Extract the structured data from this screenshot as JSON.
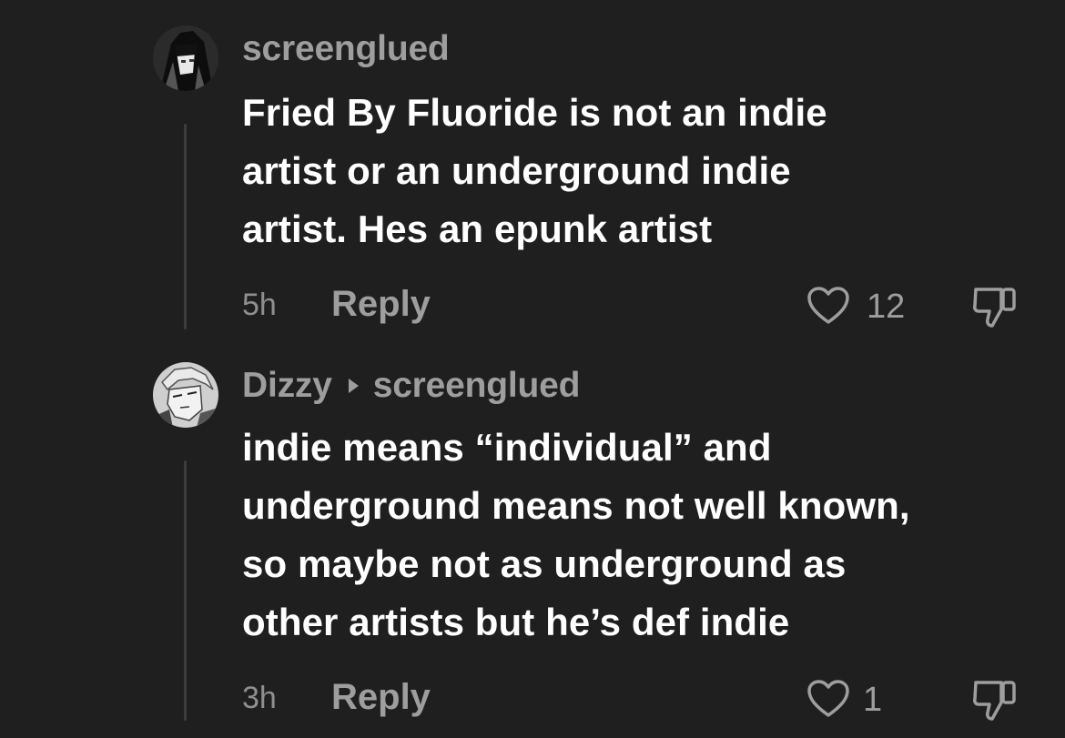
{
  "comments": [
    {
      "username": "screenglued",
      "reply_to": "",
      "text": "Fried By Fluoride is not an indie artist or an underground indie artist. Hes an epunk artist",
      "lines": [
        "Fried By Fluoride is not an indie",
        "artist or an underground indie",
        "artist. Hes an epunk artist"
      ],
      "time": "5h",
      "reply_label": "Reply",
      "likes": "12"
    },
    {
      "username": "Dizzy",
      "reply_to": "screenglued",
      "text": "indie means “individual” and underground means not well known, so maybe not as underground as other artists but he’s def indie",
      "lines": [
        "indie means “individual” and",
        "underground means not well known,",
        "so maybe not as underground as",
        "other artists but he’s def indie"
      ],
      "time": "3h",
      "reply_label": "Reply",
      "likes": "1"
    }
  ],
  "colors": {
    "background": "#1f1f1f",
    "text": "#ffffff",
    "muted": "#9e9e9e"
  },
  "icons": [
    "reply-arrow-icon",
    "heart-icon",
    "thumbs-down-icon"
  ]
}
